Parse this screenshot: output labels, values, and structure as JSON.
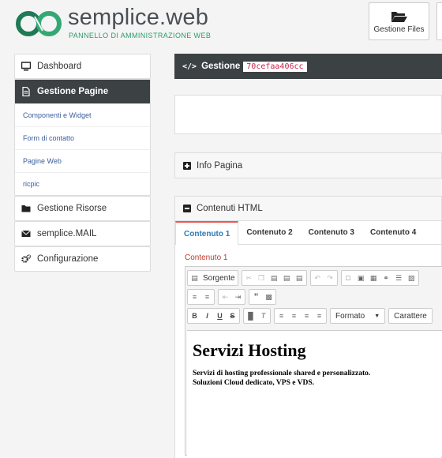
{
  "brand": {
    "name": "semplice.web",
    "subtitle": "PANNELLO DI AMMINISTRAZIONE WEB",
    "accent": "#2a9b6a"
  },
  "header": {
    "files_button": {
      "label": "Gestione Files",
      "icon": "folder-open-icon"
    }
  },
  "sidebar": {
    "items": [
      {
        "label": "Dashboard",
        "icon": "monitor-icon",
        "active": false
      },
      {
        "label": "Gestione Pagine",
        "icon": "file-icon",
        "active": true,
        "subitems": [
          "Componenti e Widget",
          "Form di contatto",
          "Pagine Web",
          "ricpic"
        ]
      },
      {
        "label": "Gestione Risorse",
        "icon": "folder-icon",
        "active": false
      },
      {
        "label": "semplice.MAIL",
        "icon": "envelope-icon",
        "active": false
      },
      {
        "label": "Configurazione",
        "icon": "cogs-icon",
        "active": false
      }
    ]
  },
  "main": {
    "title": "Gestione",
    "code": "70cefaa406cc",
    "info_panel": {
      "label": "Info Pagina",
      "icon": "plus-square-icon"
    },
    "content_panel": {
      "label": "Contenuti HTML",
      "icon": "minus-square-icon",
      "tabs": [
        "Contenuto 1",
        "Contenuto 2",
        "Contenuto 3",
        "Contenuto 4"
      ],
      "active_tab": 0,
      "section_label": "Contenuto 1"
    }
  },
  "editor": {
    "source_label": "Sorgente",
    "format_label": "Formato",
    "font_label": "Carattere",
    "heading": "Servizi Hosting",
    "lines": [
      "Servizi di hosting professionale shared e personalizzato.",
      "Soluzioni Cloud dedicato, VPS e VDS."
    ]
  }
}
